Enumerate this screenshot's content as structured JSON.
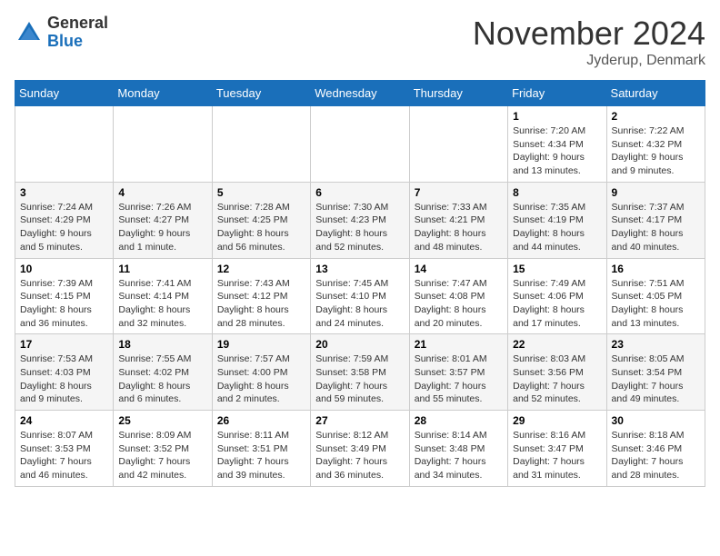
{
  "header": {
    "logo_general": "General",
    "logo_blue": "Blue",
    "month_title": "November 2024",
    "location": "Jyderup, Denmark"
  },
  "days_of_week": [
    "Sunday",
    "Monday",
    "Tuesday",
    "Wednesday",
    "Thursday",
    "Friday",
    "Saturday"
  ],
  "weeks": [
    [
      {
        "day": "",
        "info": ""
      },
      {
        "day": "",
        "info": ""
      },
      {
        "day": "",
        "info": ""
      },
      {
        "day": "",
        "info": ""
      },
      {
        "day": "",
        "info": ""
      },
      {
        "day": "1",
        "info": "Sunrise: 7:20 AM\nSunset: 4:34 PM\nDaylight: 9 hours and 13 minutes."
      },
      {
        "day": "2",
        "info": "Sunrise: 7:22 AM\nSunset: 4:32 PM\nDaylight: 9 hours and 9 minutes."
      }
    ],
    [
      {
        "day": "3",
        "info": "Sunrise: 7:24 AM\nSunset: 4:29 PM\nDaylight: 9 hours and 5 minutes."
      },
      {
        "day": "4",
        "info": "Sunrise: 7:26 AM\nSunset: 4:27 PM\nDaylight: 9 hours and 1 minute."
      },
      {
        "day": "5",
        "info": "Sunrise: 7:28 AM\nSunset: 4:25 PM\nDaylight: 8 hours and 56 minutes."
      },
      {
        "day": "6",
        "info": "Sunrise: 7:30 AM\nSunset: 4:23 PM\nDaylight: 8 hours and 52 minutes."
      },
      {
        "day": "7",
        "info": "Sunrise: 7:33 AM\nSunset: 4:21 PM\nDaylight: 8 hours and 48 minutes."
      },
      {
        "day": "8",
        "info": "Sunrise: 7:35 AM\nSunset: 4:19 PM\nDaylight: 8 hours and 44 minutes."
      },
      {
        "day": "9",
        "info": "Sunrise: 7:37 AM\nSunset: 4:17 PM\nDaylight: 8 hours and 40 minutes."
      }
    ],
    [
      {
        "day": "10",
        "info": "Sunrise: 7:39 AM\nSunset: 4:15 PM\nDaylight: 8 hours and 36 minutes."
      },
      {
        "day": "11",
        "info": "Sunrise: 7:41 AM\nSunset: 4:14 PM\nDaylight: 8 hours and 32 minutes."
      },
      {
        "day": "12",
        "info": "Sunrise: 7:43 AM\nSunset: 4:12 PM\nDaylight: 8 hours and 28 minutes."
      },
      {
        "day": "13",
        "info": "Sunrise: 7:45 AM\nSunset: 4:10 PM\nDaylight: 8 hours and 24 minutes."
      },
      {
        "day": "14",
        "info": "Sunrise: 7:47 AM\nSunset: 4:08 PM\nDaylight: 8 hours and 20 minutes."
      },
      {
        "day": "15",
        "info": "Sunrise: 7:49 AM\nSunset: 4:06 PM\nDaylight: 8 hours and 17 minutes."
      },
      {
        "day": "16",
        "info": "Sunrise: 7:51 AM\nSunset: 4:05 PM\nDaylight: 8 hours and 13 minutes."
      }
    ],
    [
      {
        "day": "17",
        "info": "Sunrise: 7:53 AM\nSunset: 4:03 PM\nDaylight: 8 hours and 9 minutes."
      },
      {
        "day": "18",
        "info": "Sunrise: 7:55 AM\nSunset: 4:02 PM\nDaylight: 8 hours and 6 minutes."
      },
      {
        "day": "19",
        "info": "Sunrise: 7:57 AM\nSunset: 4:00 PM\nDaylight: 8 hours and 2 minutes."
      },
      {
        "day": "20",
        "info": "Sunrise: 7:59 AM\nSunset: 3:58 PM\nDaylight: 7 hours and 59 minutes."
      },
      {
        "day": "21",
        "info": "Sunrise: 8:01 AM\nSunset: 3:57 PM\nDaylight: 7 hours and 55 minutes."
      },
      {
        "day": "22",
        "info": "Sunrise: 8:03 AM\nSunset: 3:56 PM\nDaylight: 7 hours and 52 minutes."
      },
      {
        "day": "23",
        "info": "Sunrise: 8:05 AM\nSunset: 3:54 PM\nDaylight: 7 hours and 49 minutes."
      }
    ],
    [
      {
        "day": "24",
        "info": "Sunrise: 8:07 AM\nSunset: 3:53 PM\nDaylight: 7 hours and 46 minutes."
      },
      {
        "day": "25",
        "info": "Sunrise: 8:09 AM\nSunset: 3:52 PM\nDaylight: 7 hours and 42 minutes."
      },
      {
        "day": "26",
        "info": "Sunrise: 8:11 AM\nSunset: 3:51 PM\nDaylight: 7 hours and 39 minutes."
      },
      {
        "day": "27",
        "info": "Sunrise: 8:12 AM\nSunset: 3:49 PM\nDaylight: 7 hours and 36 minutes."
      },
      {
        "day": "28",
        "info": "Sunrise: 8:14 AM\nSunset: 3:48 PM\nDaylight: 7 hours and 34 minutes."
      },
      {
        "day": "29",
        "info": "Sunrise: 8:16 AM\nSunset: 3:47 PM\nDaylight: 7 hours and 31 minutes."
      },
      {
        "day": "30",
        "info": "Sunrise: 8:18 AM\nSunset: 3:46 PM\nDaylight: 7 hours and 28 minutes."
      }
    ]
  ]
}
